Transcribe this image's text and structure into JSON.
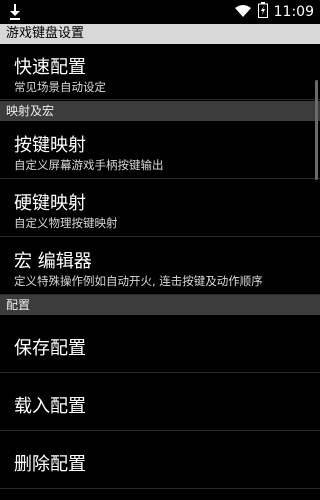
{
  "status_bar": {
    "time": "11:09",
    "icons": [
      "download-icon",
      "wifi-icon",
      "battery-icon"
    ]
  },
  "title": "游戏键盘设置",
  "sections": {
    "mapping_macro": "映射及宏",
    "config": "配置"
  },
  "items": {
    "quick_config": {
      "title": "快速配置",
      "subtitle": "常见场景自动设定"
    },
    "key_mapping": {
      "title": "按键映射",
      "subtitle": "自定义屏幕游戏手柄按键输出"
    },
    "hard_key_mapping": {
      "title": "硬键映射",
      "subtitle": "自定义物理按键映射"
    },
    "macro_editor": {
      "title": "宏 编辑器",
      "subtitle": "定义特殊操作例如自动开火, 连击按键及动作顺序"
    },
    "save_config": {
      "title": "保存配置"
    },
    "load_config": {
      "title": "载入配置"
    },
    "delete_config": {
      "title": "删除配置"
    }
  },
  "colors": {
    "background": "#000000",
    "title_bar": "#d8d8d8",
    "section_header": "#3c3c3c"
  }
}
